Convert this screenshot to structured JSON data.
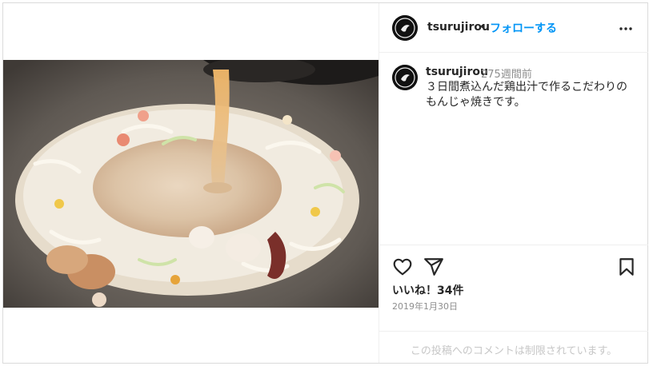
{
  "post": {
    "username": "tsurujirou",
    "separator": "•",
    "follow_label": "フォローする",
    "caption_username": "tsurujirou",
    "time_ago": "275週間前",
    "caption_line1": "３日間煮込んだ鶏出汁で作るこだわりの",
    "caption_line2": "もんじゃ焼きです。",
    "likes_prefix": "いいね！",
    "likes_count": "34件",
    "date": "2019年1月30日",
    "comments_disabled": "この投稿へのコメントは制限されています。"
  },
  "icons": {
    "more": "more-options-icon",
    "like": "heart-icon",
    "share": "share-icon",
    "save": "bookmark-icon"
  },
  "colors": {
    "link": "#0095f6",
    "muted": "#8e8e8e",
    "border": "#dbdbdb"
  }
}
